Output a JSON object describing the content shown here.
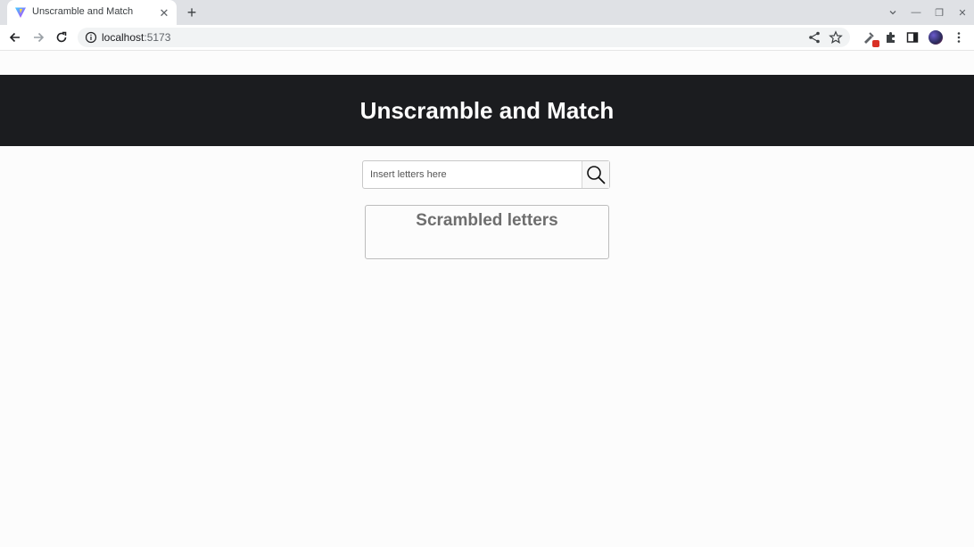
{
  "browser": {
    "tab": {
      "title": "Unscramble and Match",
      "close_glyph": "✕"
    },
    "new_tab_glyph": "+",
    "window_controls": {
      "dropdown_icon": "chevron-down-icon",
      "minimize_glyph": "—",
      "restore_glyph": "❐",
      "close_glyph": "✕"
    },
    "address_bar": {
      "host": "localhost",
      "port": ":5173"
    },
    "toolbar_icons": [
      "back-icon",
      "forward-icon",
      "reload-icon",
      "info-icon",
      "share-icon",
      "star-icon",
      "extension-pin-icon",
      "extensions-icon",
      "side-panel-icon",
      "profile-avatar",
      "menu-icon"
    ]
  },
  "page": {
    "header": {
      "title": "Unscramble and Match",
      "background": "#1b1c1f",
      "color": "#ffffff"
    },
    "search": {
      "value": "",
      "placeholder": "Insert letters here",
      "button_icon": "search-icon"
    },
    "scrambled": {
      "heading": "Scrambled letters",
      "letters": ""
    }
  }
}
